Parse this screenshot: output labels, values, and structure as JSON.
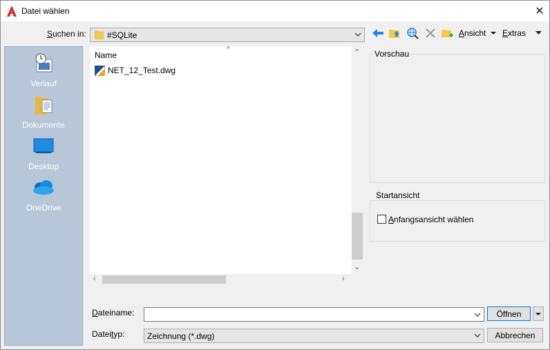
{
  "window": {
    "title": "Datei wählen",
    "close_glyph": "✕"
  },
  "lookin": {
    "label_pre": "",
    "label_u": "S",
    "label_post": "uchen in:",
    "value": "#SQLite"
  },
  "toolbar": {
    "view_u": "A",
    "view_rest": "nsicht",
    "tools_u": "E",
    "tools_rest": "xtras"
  },
  "places": [
    {
      "label": "Verlauf",
      "icon": "history-icon"
    },
    {
      "label": "Dokumente",
      "icon": "documents-folder-icon"
    },
    {
      "label": "Desktop",
      "icon": "desktop-icon"
    },
    {
      "label": "OneDrive",
      "icon": "onedrive-cloud-icon"
    }
  ],
  "filelist": {
    "column_name": "Name",
    "sort_caret": "^",
    "files": [
      {
        "name": "NET_12_Test.dwg",
        "icon": "dwg-file-icon"
      }
    ]
  },
  "preview": {
    "title": "Vorschau"
  },
  "initial_view": {
    "title": "Startansicht",
    "checkbox_u": "A",
    "checkbox_rest": "nfangsansicht wählen",
    "checked": false
  },
  "filename": {
    "label_u": "D",
    "label_rest": "ateiname:",
    "value": ""
  },
  "filetype": {
    "label_pre": "Datei",
    "label_u": "t",
    "label_post": "yp:",
    "value": "Zeichnung (*.dwg)"
  },
  "buttons": {
    "open": "Öffnen",
    "cancel": "Abbrechen"
  },
  "colors": {
    "places_bg": "#b7c7d7",
    "accent_blue": "#0078d7",
    "autocad_red": "#d42c2c"
  }
}
